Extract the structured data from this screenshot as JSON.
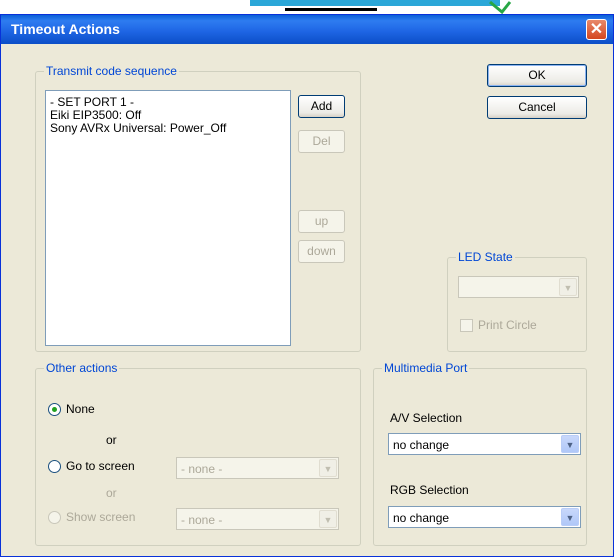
{
  "window": {
    "title": "Timeout Actions",
    "close_glyph": "✕"
  },
  "buttons": {
    "ok": "OK",
    "cancel": "Cancel"
  },
  "transmit": {
    "group_label": "Transmit code sequence",
    "items": [
      "- SET PORT 1 -",
      "Eiki EIP3500: Off",
      "Sony AVRx Universal: Power_Off"
    ],
    "add": "Add",
    "del": "Del",
    "up": "up",
    "down": "down"
  },
  "led": {
    "group_label": "LED State",
    "value": "",
    "print_circle": "Print Circle"
  },
  "other": {
    "group_label": "Other actions",
    "none": "None",
    "or1": "or",
    "goto_screen": "Go to screen",
    "goto_value": "- none -",
    "or2": "or",
    "show_screen": "Show screen",
    "show_value": "- none -"
  },
  "multimedia": {
    "group_label": "Multimedia Port",
    "av_label": "A/V Selection",
    "av_value": "no change",
    "rgb_label": "RGB Selection",
    "rgb_value": "no change"
  },
  "colors": {
    "title_bar": "#0a5fd8",
    "group_label": "#0046d5",
    "face": "#ece9d8"
  }
}
